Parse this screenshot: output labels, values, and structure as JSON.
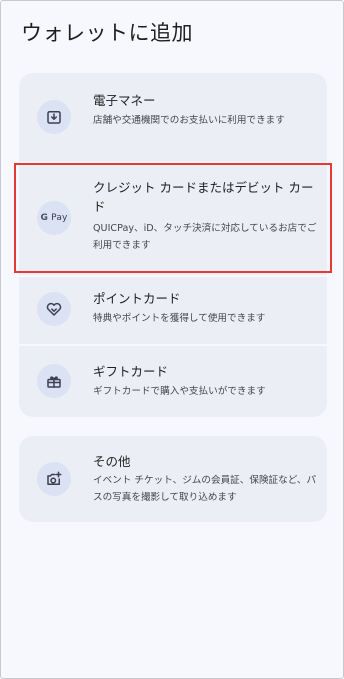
{
  "page": {
    "title": "ウォレットに追加"
  },
  "options": [
    {
      "title": "電子マネー",
      "description": "店舗や交通機関でのお支払いに利用できます",
      "icon": "emoney-icon"
    },
    {
      "title": "クレジット カードまたはデビット カード",
      "description": "QUICPay、iD、タッチ決済に対応しているお店でご利用できます",
      "icon": "gpay-icon",
      "icon_text_g": "G",
      "icon_text_pay": "Pay"
    },
    {
      "title": "ポイントカード",
      "description": "特典やポイントを獲得して使用できます",
      "icon": "loyalty-heart-icon"
    },
    {
      "title": "ギフトカード",
      "description": "ギフトカードで購入や支払いができます",
      "icon": "gift-icon"
    },
    {
      "title": "その他",
      "description": "イベント チケット、ジムの会員証、保険証など、パスの写真を撮影して取り込めます",
      "icon": "camera-add-icon"
    }
  ],
  "colors": {
    "background": "#f7f8fd",
    "card": "#eceef5",
    "icon_circle": "#dbe2f3",
    "highlight": "#e53935",
    "icon_stroke": "#3c4150"
  }
}
